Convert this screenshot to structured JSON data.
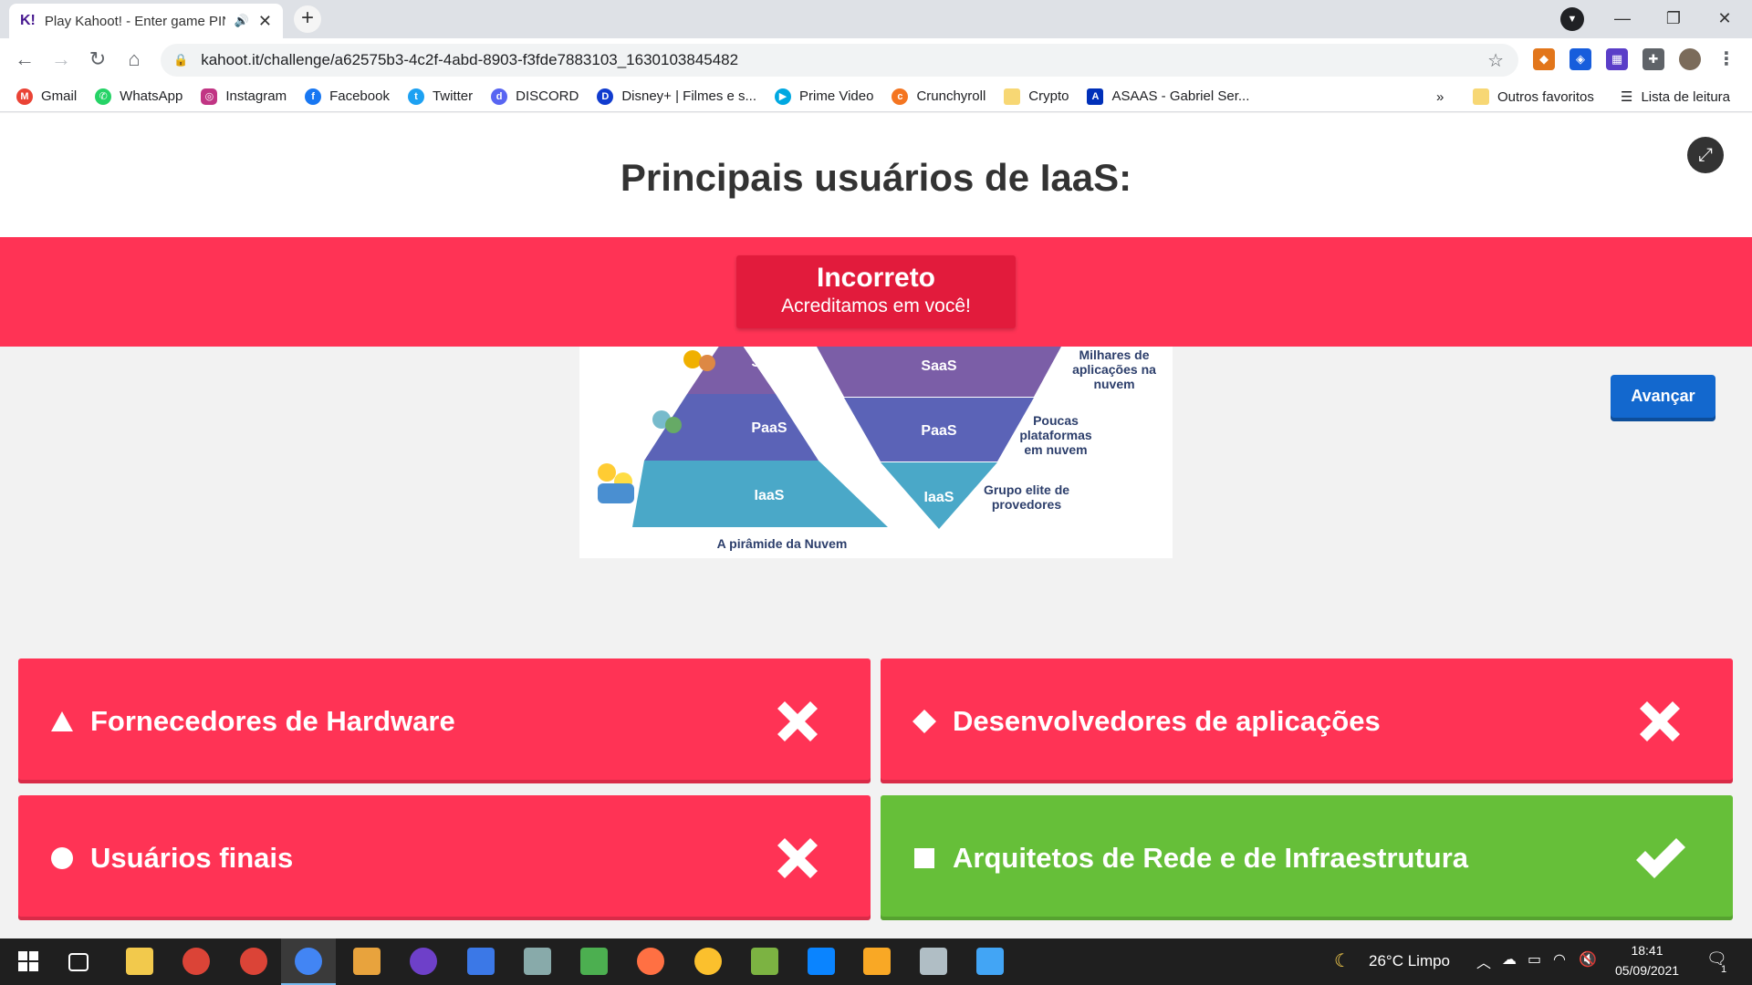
{
  "browser": {
    "tab_title": "Play Kahoot! - Enter game PIN",
    "tab_favicon": "K!",
    "url": "kahoot.it/challenge/a62575b3-4c2f-4abd-8903-f3fde7883103_1630103845482",
    "bookmarks": [
      {
        "label": "Gmail",
        "icon": "gmail-icon",
        "color": "#ea4335"
      },
      {
        "label": "WhatsApp",
        "icon": "whatsapp-icon",
        "color": "#25d366"
      },
      {
        "label": "Instagram",
        "icon": "instagram-icon",
        "color": "#c13584"
      },
      {
        "label": "Facebook",
        "icon": "facebook-icon",
        "color": "#1877f2"
      },
      {
        "label": "Twitter",
        "icon": "twitter-icon",
        "color": "#1da1f2"
      },
      {
        "label": "DISCORD",
        "icon": "discord-icon",
        "color": "#5865f2"
      },
      {
        "label": "Disney+ | Filmes e s...",
        "icon": "disney-icon",
        "color": "#113ccf"
      },
      {
        "label": "Prime Video",
        "icon": "prime-video-icon",
        "color": "#00a8e1"
      },
      {
        "label": "Crunchyroll",
        "icon": "crunchyroll-icon",
        "color": "#f47521"
      },
      {
        "label": "Crypto",
        "icon": "folder-icon",
        "color": "#f7d774"
      },
      {
        "label": "ASAAS - Gabriel Ser...",
        "icon": "asaas-icon",
        "color": "#0030b9"
      }
    ],
    "more_bookmarks": "»",
    "other_bookmarks": "Outros favoritos",
    "reading_list": "Lista de leitura"
  },
  "question": {
    "title": "Principais usuários de IaaS:"
  },
  "result": {
    "heading": "Incorreto",
    "message": "Acreditamos em você!"
  },
  "figure": {
    "left_levels": [
      "SaaS",
      "PaaS",
      "IaaS"
    ],
    "right_levels": [
      "SaaS",
      "PaaS",
      "IaaS"
    ],
    "right_notes": [
      [
        "Milhares de",
        "aplicações na",
        "nuvem"
      ],
      [
        "Poucas",
        "plataformas",
        "em nuvem"
      ],
      [
        "Grupo elite de",
        "provedores"
      ]
    ],
    "caption": "A pirâmide da Nuvem"
  },
  "next_button": "Avançar",
  "answers": [
    {
      "text": "Fornecedores de Hardware",
      "shape": "triangle",
      "correct": false
    },
    {
      "text": "Desenvolvedores de aplicações",
      "shape": "diamond",
      "correct": false
    },
    {
      "text": "Usuários finais",
      "shape": "circle",
      "correct": false
    },
    {
      "text": "Arquitetos de Rede e de Infraestrutura",
      "shape": "square",
      "correct": true
    }
  ],
  "colors": {
    "wrong": "#ff3355",
    "correct": "#66bf39",
    "result_box": "#e21b3c",
    "next_button": "#1368ce"
  },
  "taskbar": {
    "weather": "26°C  Limpo",
    "time": "18:41",
    "date": "05/09/2021",
    "notifications": "1"
  }
}
